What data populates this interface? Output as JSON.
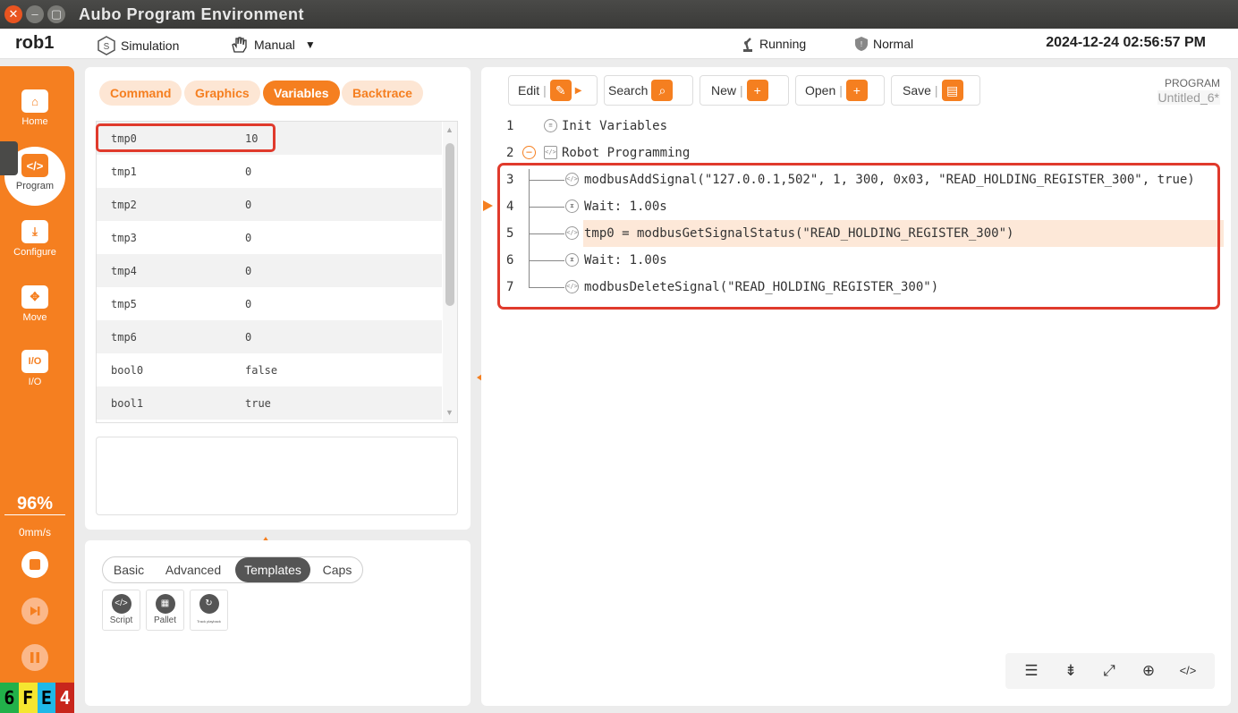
{
  "window": {
    "title": "Aubo Program Environment"
  },
  "header": {
    "robot_name": "rob1",
    "mode": "Simulation",
    "control": "Manual",
    "status": "Running",
    "safety": "Normal",
    "datetime": "2024-12-24 02:56:57 PM"
  },
  "nav": {
    "items": [
      {
        "label": "Home"
      },
      {
        "label": "Program"
      },
      {
        "label": "Configure"
      },
      {
        "label": "Move"
      },
      {
        "label": "I/O"
      }
    ],
    "speed_percent": "96%",
    "speed_mm": "0mm/s",
    "badge": [
      "6",
      "F",
      "E",
      "4"
    ]
  },
  "var_panel": {
    "tabs": [
      "Command",
      "Graphics",
      "Variables",
      "Backtrace"
    ],
    "active_tab": "Variables",
    "variables": [
      {
        "name": "tmp0",
        "value": "10"
      },
      {
        "name": "tmp1",
        "value": "0"
      },
      {
        "name": "tmp2",
        "value": "0"
      },
      {
        "name": "tmp3",
        "value": "0"
      },
      {
        "name": "tmp4",
        "value": "0"
      },
      {
        "name": "tmp5",
        "value": "0"
      },
      {
        "name": "tmp6",
        "value": "0"
      },
      {
        "name": "bool0",
        "value": "false"
      },
      {
        "name": "bool1",
        "value": "true"
      }
    ]
  },
  "block_panel": {
    "segments": [
      "Basic",
      "Advanced",
      "Templates",
      "Caps"
    ],
    "active_segment": "Templates",
    "templates": [
      {
        "label": "Script"
      },
      {
        "label": "Pallet"
      },
      {
        "label": "Track playback"
      }
    ]
  },
  "program": {
    "toolbar": {
      "edit": "Edit",
      "search": "Search",
      "new": "New",
      "open": "Open",
      "save": "Save"
    },
    "label": "PROGRAM",
    "name": "Untitled_6*",
    "lines": [
      {
        "num": "1",
        "text": "Init Variables"
      },
      {
        "num": "2",
        "text": "Robot Programming"
      },
      {
        "num": "3",
        "text": "modbusAddSignal(\"127.0.0.1,502\", 1, 300, 0x03, \"READ_HOLDING_REGISTER_300\", true)"
      },
      {
        "num": "4",
        "text": "Wait: 1.00s"
      },
      {
        "num": "5",
        "text": "tmp0 = modbusGetSignalStatus(\"READ_HOLDING_REGISTER_300\")"
      },
      {
        "num": "6",
        "text": "Wait: 1.00s"
      },
      {
        "num": "7",
        "text": "modbusDeleteSignal(\"READ_HOLDING_REGISTER_300\")"
      }
    ]
  },
  "colors": {
    "accent": "#f57f20",
    "highlight": "#e03a2c",
    "row_active": "#fde8d8"
  }
}
